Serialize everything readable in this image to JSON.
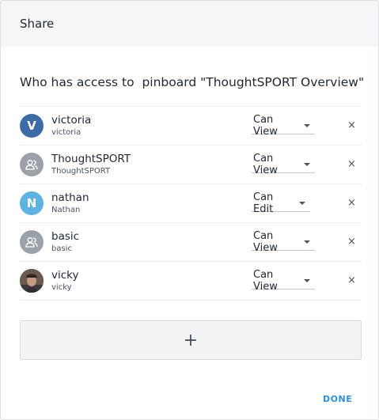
{
  "dialog": {
    "title": "Share",
    "subtitle": "Who has access to  pinboard \"ThoughtSPORT Overview\"",
    "add_label": "+",
    "done_label": "DONE"
  },
  "colors": {
    "accent": "#2f8fd8",
    "victoria_avatar": "#3d6aa8",
    "nathan_avatar": "#5db4e4",
    "group_avatar": "#9ba1a8"
  },
  "users": [
    {
      "name": "victoria",
      "username": "victoria",
      "avatar_letter": "V",
      "avatar_type": "letter",
      "permission": "Can View",
      "remove": "×"
    },
    {
      "name": "ThoughtSPORT",
      "username": "ThoughtSPORT",
      "avatar_type": "group-icon",
      "permission": "Can View",
      "remove": "×"
    },
    {
      "name": "nathan",
      "username": "Nathan",
      "avatar_letter": "N",
      "avatar_type": "letter",
      "permission": "Can Edit",
      "remove": "×"
    },
    {
      "name": "basic",
      "username": "basic",
      "avatar_type": "group-icon",
      "permission": "Can View",
      "remove": "×"
    },
    {
      "name": "vicky",
      "username": "vicky",
      "avatar_type": "photo",
      "permission": "Can View",
      "remove": "×"
    }
  ]
}
